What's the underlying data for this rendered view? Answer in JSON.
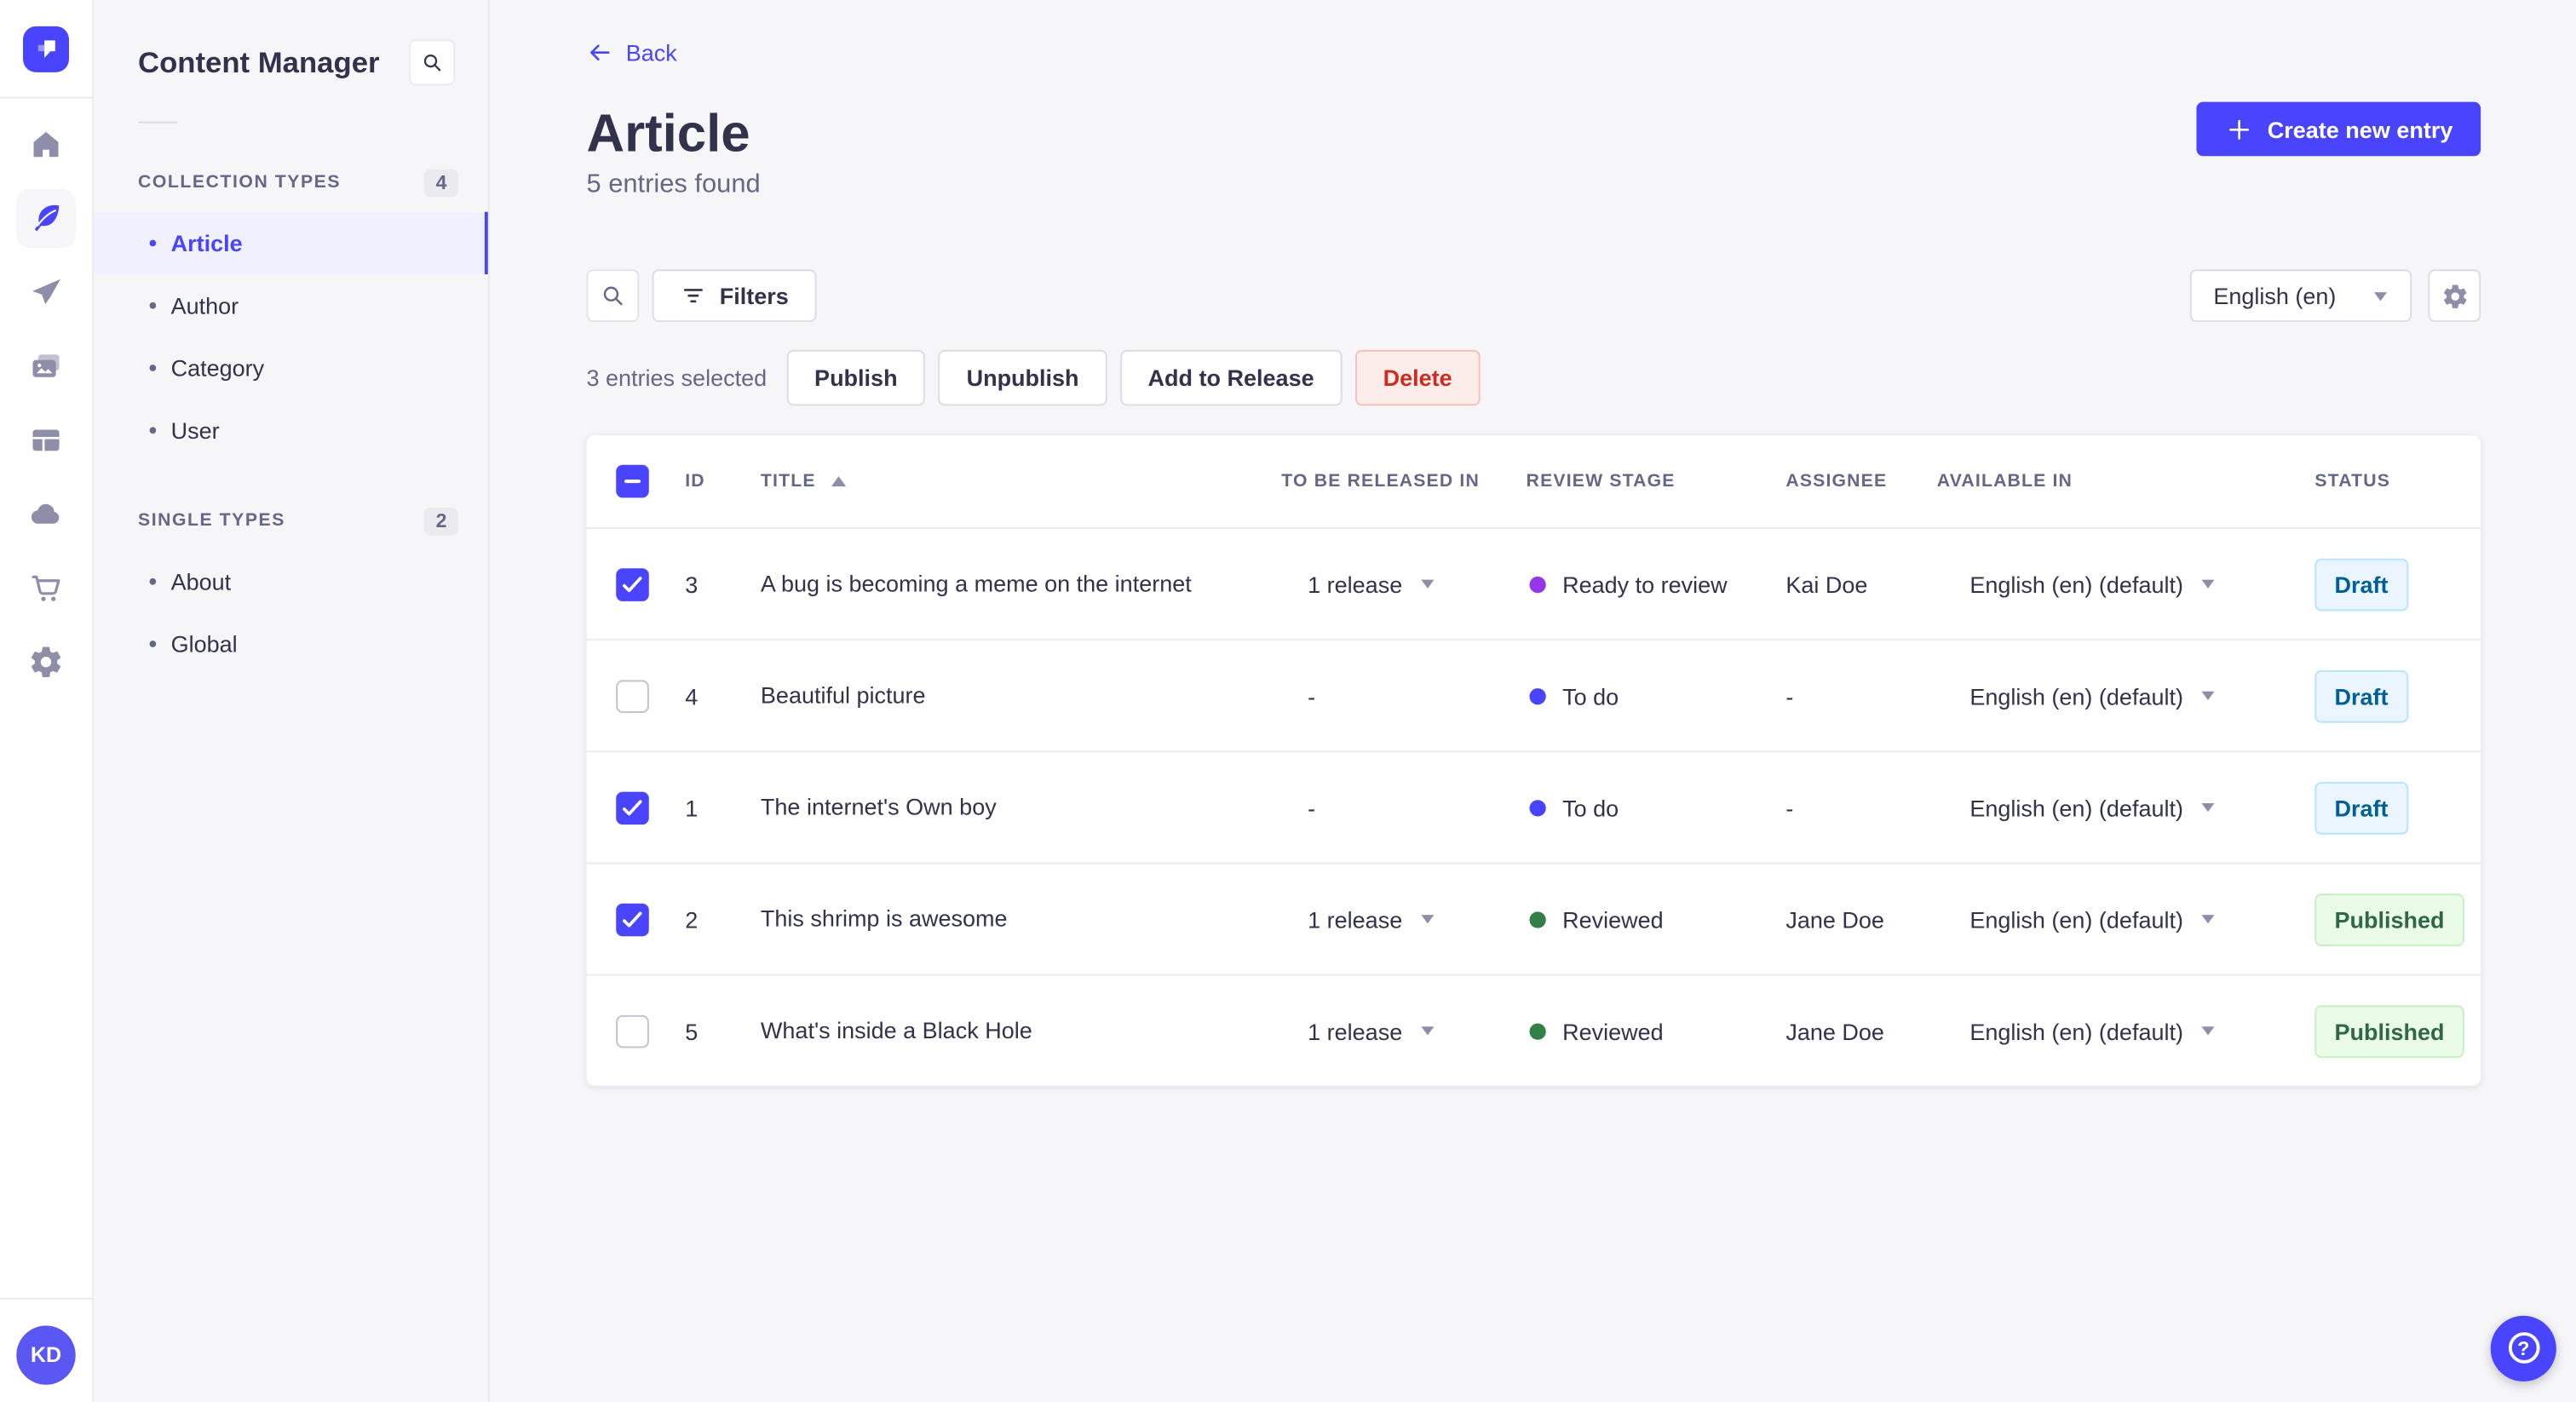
{
  "theme": {
    "brand": "#4945ff",
    "text_dark": "#32324d",
    "text_muted": "#666687",
    "page_bg": "#f6f6f9",
    "border": "#dcdce4",
    "divider": "#eaeaef",
    "active_item_bg": "#f0f0ff",
    "danger_text": "#d02b20",
    "danger_bg": "#fcecea",
    "draft_bg": "#eaf5ff",
    "draft_text": "#006096",
    "published_bg": "#eafbe7",
    "published_text": "#2f6846",
    "stage_todo": "#4945ff",
    "stage_ready": "#9736e8",
    "stage_reviewed": "#328048"
  },
  "rail": {
    "icons": [
      "home-icon",
      "content-manager-icon",
      "releases-icon",
      "media-library-icon",
      "content-type-builder-icon",
      "deploy-icon",
      "marketplace-icon",
      "settings-icon"
    ],
    "active_icon": "content-manager-icon",
    "avatar_initials": "KD"
  },
  "sidebar": {
    "title": "Content Manager",
    "sections": [
      {
        "label": "COLLECTION TYPES",
        "count": "4",
        "items": [
          {
            "label": "Article",
            "active": true
          },
          {
            "label": "Author",
            "active": false
          },
          {
            "label": "Category",
            "active": false
          },
          {
            "label": "User",
            "active": false
          }
        ]
      },
      {
        "label": "SINGLE TYPES",
        "count": "2",
        "items": [
          {
            "label": "About",
            "active": false
          },
          {
            "label": "Global",
            "active": false
          }
        ]
      }
    ]
  },
  "header": {
    "back_label": "Back",
    "title": "Article",
    "subtitle": "5 entries found",
    "create_button": "Create new entry"
  },
  "toolbar": {
    "filters_label": "Filters",
    "locale": "English (en)"
  },
  "bulk": {
    "selected_text": "3 entries selected",
    "publish": "Publish",
    "unpublish": "Unpublish",
    "add_to_release": "Add to Release",
    "delete": "Delete"
  },
  "table": {
    "select_all_state": "indeterminate",
    "columns": [
      "ID",
      "TITLE",
      "TO BE RELEASED IN",
      "REVIEW STAGE",
      "ASSIGNEE",
      "AVAILABLE IN",
      "STATUS"
    ],
    "sort": {
      "column": "TITLE",
      "direction": "ascending"
    },
    "rows": [
      {
        "selected": true,
        "id": "3",
        "title": "A bug is becoming a meme on the internet",
        "release": "1 release",
        "release_menu": true,
        "stage": "Ready to review",
        "stage_key": "ready",
        "assignee": "Kai Doe",
        "locale": "English (en) (default)",
        "status": "Draft",
        "status_variant": "draft"
      },
      {
        "selected": false,
        "id": "4",
        "title": "Beautiful picture",
        "release": "-",
        "release_menu": false,
        "stage": "To do",
        "stage_key": "todo",
        "assignee": "-",
        "locale": "English (en) (default)",
        "status": "Draft",
        "status_variant": "draft"
      },
      {
        "selected": true,
        "id": "1",
        "title": "The internet's Own boy",
        "release": "-",
        "release_menu": false,
        "stage": "To do",
        "stage_key": "todo",
        "assignee": "-",
        "locale": "English (en) (default)",
        "status": "Draft",
        "status_variant": "draft"
      },
      {
        "selected": true,
        "id": "2",
        "title": "This shrimp is awesome",
        "release": "1 release",
        "release_menu": true,
        "stage": "Reviewed",
        "stage_key": "reviewed",
        "assignee": "Jane Doe",
        "locale": "English (en) (default)",
        "status": "Published",
        "status_variant": "published"
      },
      {
        "selected": false,
        "id": "5",
        "title": "What's inside a Black Hole",
        "release": "1 release",
        "release_menu": true,
        "stage": "Reviewed",
        "stage_key": "reviewed",
        "assignee": "Jane Doe",
        "locale": "English (en) (default)",
        "status": "Published",
        "status_variant": "published"
      }
    ]
  },
  "fab": {
    "help_symbol": "?"
  }
}
